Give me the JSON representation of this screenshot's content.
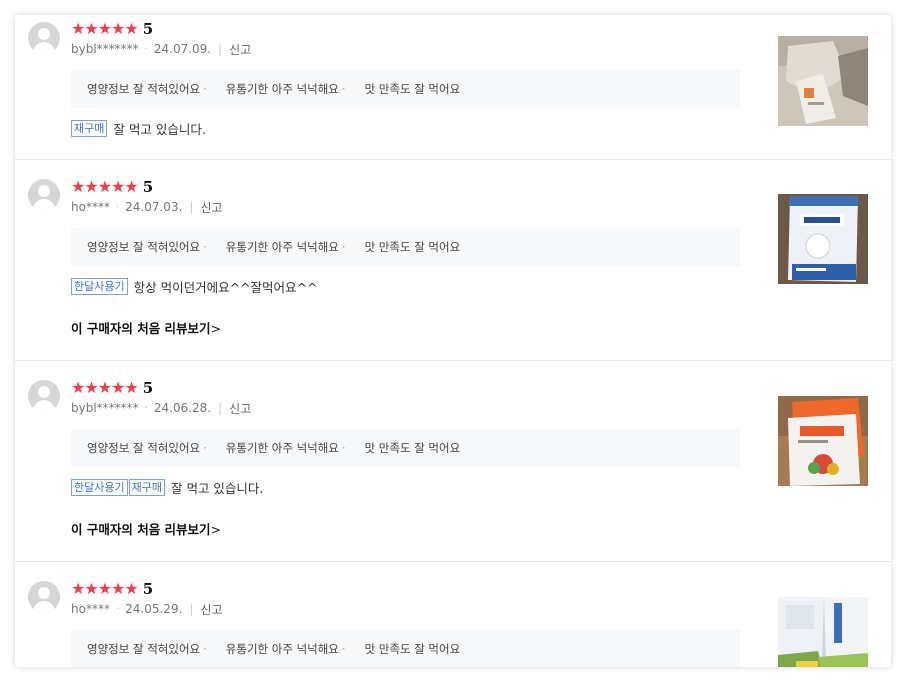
{
  "summary": {
    "items": [
      "영양정보 잘 적혀있어요",
      "유통기한 아주 넉넉해요",
      "맛 만족도 잘 먹어요"
    ],
    "separator": "·"
  },
  "labels": {
    "report": "신고",
    "first_review_link": "이 구매자의 처음 리뷰보기",
    "chevron": ">"
  },
  "reviews": [
    {
      "rating": "5",
      "user": "bybl*******",
      "date": "24.07.09.",
      "tags": [
        "재구매"
      ],
      "text": "잘 먹고 있습니다.",
      "thumb_icon": "product-photo-package-corner"
    },
    {
      "rating": "5",
      "user": "ho****",
      "date": "24.07.03.",
      "tags": [
        "한달사용기"
      ],
      "text": "항상 먹이던거에요^^잘먹어요^^",
      "thumb_icon": "product-photo-food-bag-blue"
    },
    {
      "rating": "5",
      "user": "bybl*******",
      "date": "24.06.28.",
      "tags": [
        "한달사용기",
        "재구매"
      ],
      "text": "잘 먹고 있습니다.",
      "thumb_icon": "product-photo-food-bag-orange"
    },
    {
      "rating": "5",
      "user": "ho****",
      "date": "24.05.29.",
      "tags": [],
      "text": "",
      "thumb_icon": "product-photo-food-bags-pile"
    }
  ],
  "colors": {
    "star": "#f0404e",
    "tag": "#3f74c8",
    "summary_bg": "#f7f8fa"
  }
}
